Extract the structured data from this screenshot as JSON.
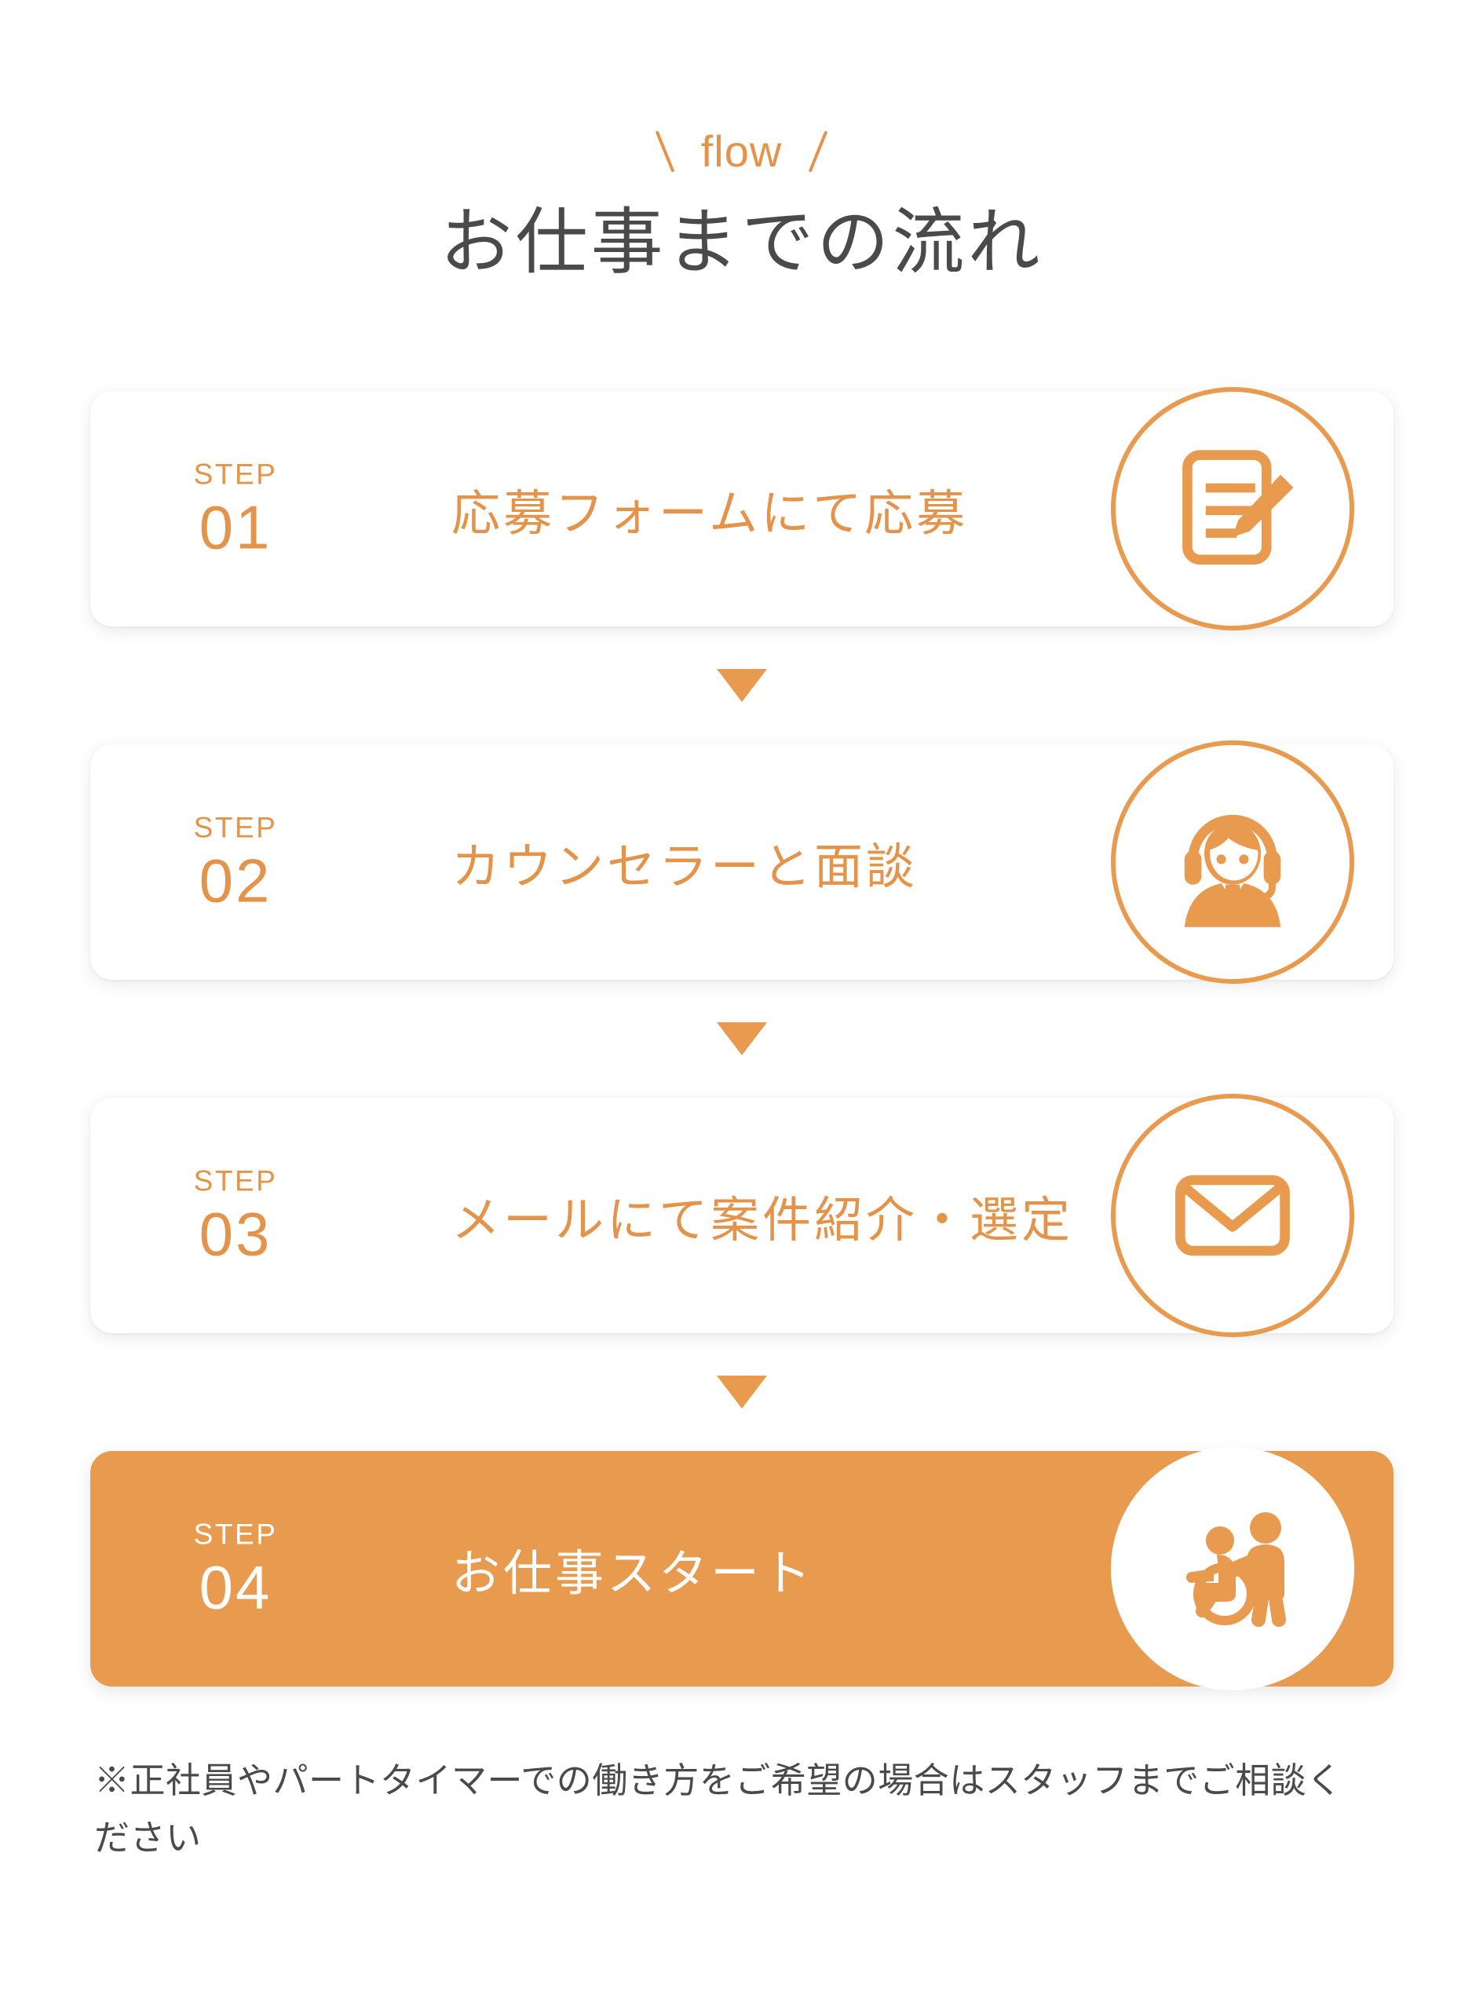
{
  "header": {
    "eyebrow": "flow",
    "title": "お仕事までの流れ"
  },
  "colors": {
    "accent": "#E3944A",
    "accent_fill": "#E89A4F",
    "title_text": "#4A4A4A",
    "card_bg": "#FFFFFF",
    "page_bg": "#FFFFFF",
    "active_text": "#FFFFFF"
  },
  "steps": [
    {
      "step_word": "STEP",
      "number": "01",
      "title": "応募フォームにて応募",
      "icon": "document-pencil-icon",
      "active": false
    },
    {
      "step_word": "STEP",
      "number": "02",
      "title": "カウンセラーと面談",
      "icon": "headset-operator-icon",
      "active": false
    },
    {
      "step_word": "STEP",
      "number": "03",
      "title": "メールにて案件紹介・選定",
      "icon": "envelope-icon",
      "active": false
    },
    {
      "step_word": "STEP",
      "number": "04",
      "title": "お仕事スタート",
      "icon": "wheelchair-assist-icon",
      "active": true
    }
  ],
  "connector_icon": "triangle-down-icon",
  "footnote": "※正社員やパートタイマーでの働き方をご希望の場合はスタッフまでご相談ください"
}
